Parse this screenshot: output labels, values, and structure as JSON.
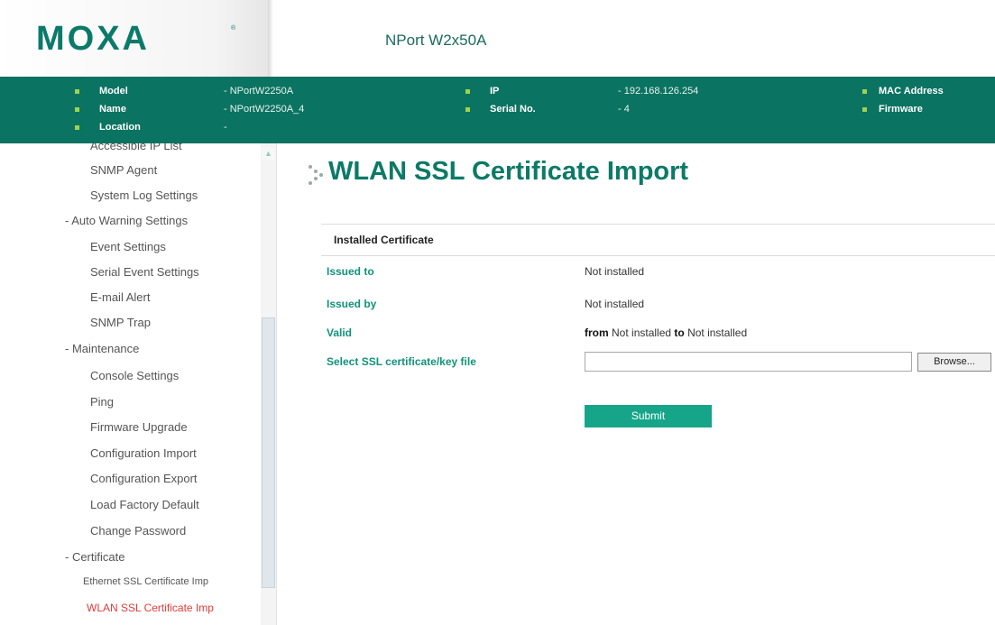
{
  "header": {
    "logo_text": "MOXA",
    "logo_tm": "®",
    "product_name": "NPort W2x50A"
  },
  "infobar": {
    "model_label": "Model",
    "model_value": "- NPortW2250A",
    "name_label": "Name",
    "name_value": "- NPortW2250A_4",
    "location_label": "Location",
    "location_value": "-",
    "ip_label": "IP",
    "ip_value": "- 192.168.126.254",
    "serial_label": "Serial No.",
    "serial_value": "- 4",
    "mac_label": "MAC Address",
    "firmware_label": "Firmware",
    "bullet_color": "#9fd34f",
    "bar_color": "#0b7361"
  },
  "sidebar": {
    "items": [
      {
        "label": "Accessible IP List",
        "clipped": true
      },
      {
        "label": "SNMP Agent"
      },
      {
        "label": "System Log Settings"
      },
      {
        "label": "- Auto Warning Settings"
      },
      {
        "label": "Event Settings"
      },
      {
        "label": "Serial Event Settings"
      },
      {
        "label": "E-mail Alert"
      },
      {
        "label": "SNMP Trap"
      },
      {
        "label": "- Maintenance"
      },
      {
        "label": "Console Settings"
      },
      {
        "label": "Ping"
      },
      {
        "label": "Firmware Upgrade"
      },
      {
        "label": "Configuration Import"
      },
      {
        "label": "Configuration Export"
      },
      {
        "label": "Load Factory Default"
      },
      {
        "label": "Change Password"
      },
      {
        "label": "- Certificate"
      },
      {
        "label": "Ethernet SSL Certificate Imp"
      },
      {
        "label": "WLAN SSL Certificate Imp",
        "active": true
      }
    ],
    "scroll_up_icon": "chevron-up-icon"
  },
  "main": {
    "title": "WLAN SSL Certificate Import",
    "title_icon": "dotted-arrow-icon",
    "section_header": "Installed Certificate",
    "issued_to_label": "Issued to",
    "issued_to_value": "Not installed",
    "issued_by_label": "Issued by",
    "issued_by_value": "Not installed",
    "valid_label": "Valid",
    "valid_from_kw": "from",
    "valid_from_value": "Not installed",
    "valid_to_kw": "to",
    "valid_to_value": "Not installed",
    "select_file_label": "Select SSL certificate/key file",
    "file_input_value": "",
    "browse_label": "Browse...",
    "submit_label": "Submit",
    "accent_color": "#0b7a66",
    "label_color": "#11937a",
    "submit_color": "#17a58a"
  }
}
